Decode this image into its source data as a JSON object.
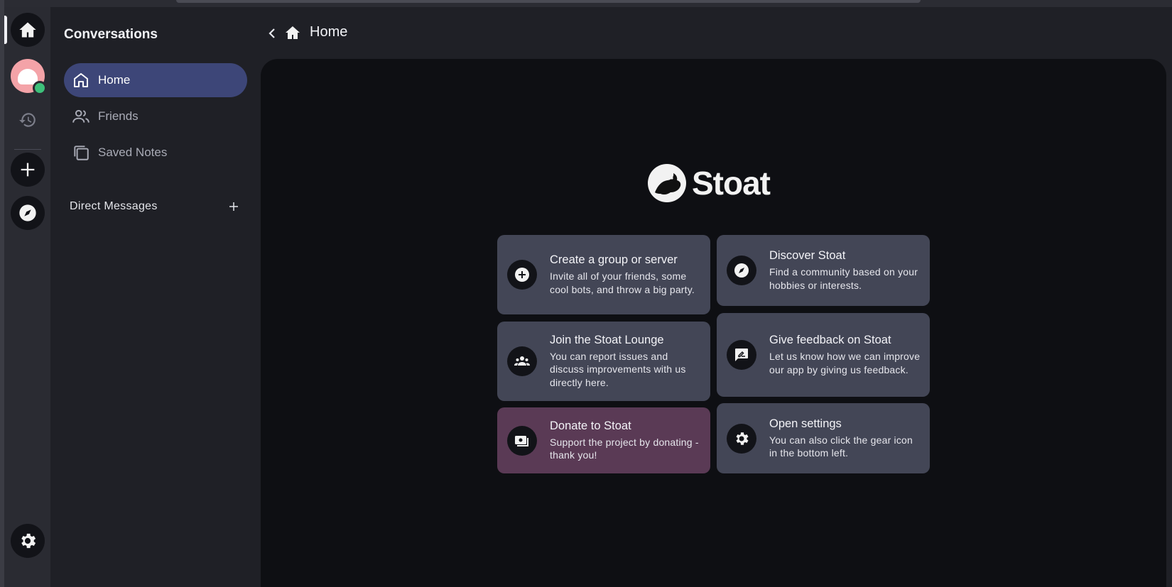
{
  "sidebar": {
    "title": "Conversations",
    "items": [
      {
        "label": "Home",
        "icon": "home-icon",
        "active": true
      },
      {
        "label": "Friends",
        "icon": "friends-icon",
        "active": false
      },
      {
        "label": "Saved Notes",
        "icon": "notes-icon",
        "active": false
      }
    ],
    "dm_header": "Direct Messages"
  },
  "header": {
    "title": "Home"
  },
  "logo": {
    "text": "Stoat"
  },
  "cards": [
    {
      "title": "Create a group or server",
      "desc": "Invite all of your friends, some cool bots, and throw a big party.",
      "icon": "plus-circle-icon"
    },
    {
      "title": "Discover Stoat",
      "desc": "Find a community based on your hobbies or interests.",
      "icon": "compass-icon"
    },
    {
      "title": "Join the Stoat Lounge",
      "desc": "You can report issues and discuss improvements with us directly here.",
      "icon": "group-icon"
    },
    {
      "title": "Give feedback on Stoat",
      "desc": "Let us know how we can improve our app by giving us feedback.",
      "icon": "feedback-icon"
    },
    {
      "title": "Donate to Stoat",
      "desc": "Support the project by donating - thank you!",
      "icon": "donate-icon"
    },
    {
      "title": "Open settings",
      "desc": "You can also click the gear icon in the bottom left.",
      "icon": "gear-icon"
    }
  ],
  "colors": {
    "accent": "#3d4678",
    "card": "#434656",
    "donate_card": "#5a3a55",
    "online_status": "#3ec07a"
  }
}
